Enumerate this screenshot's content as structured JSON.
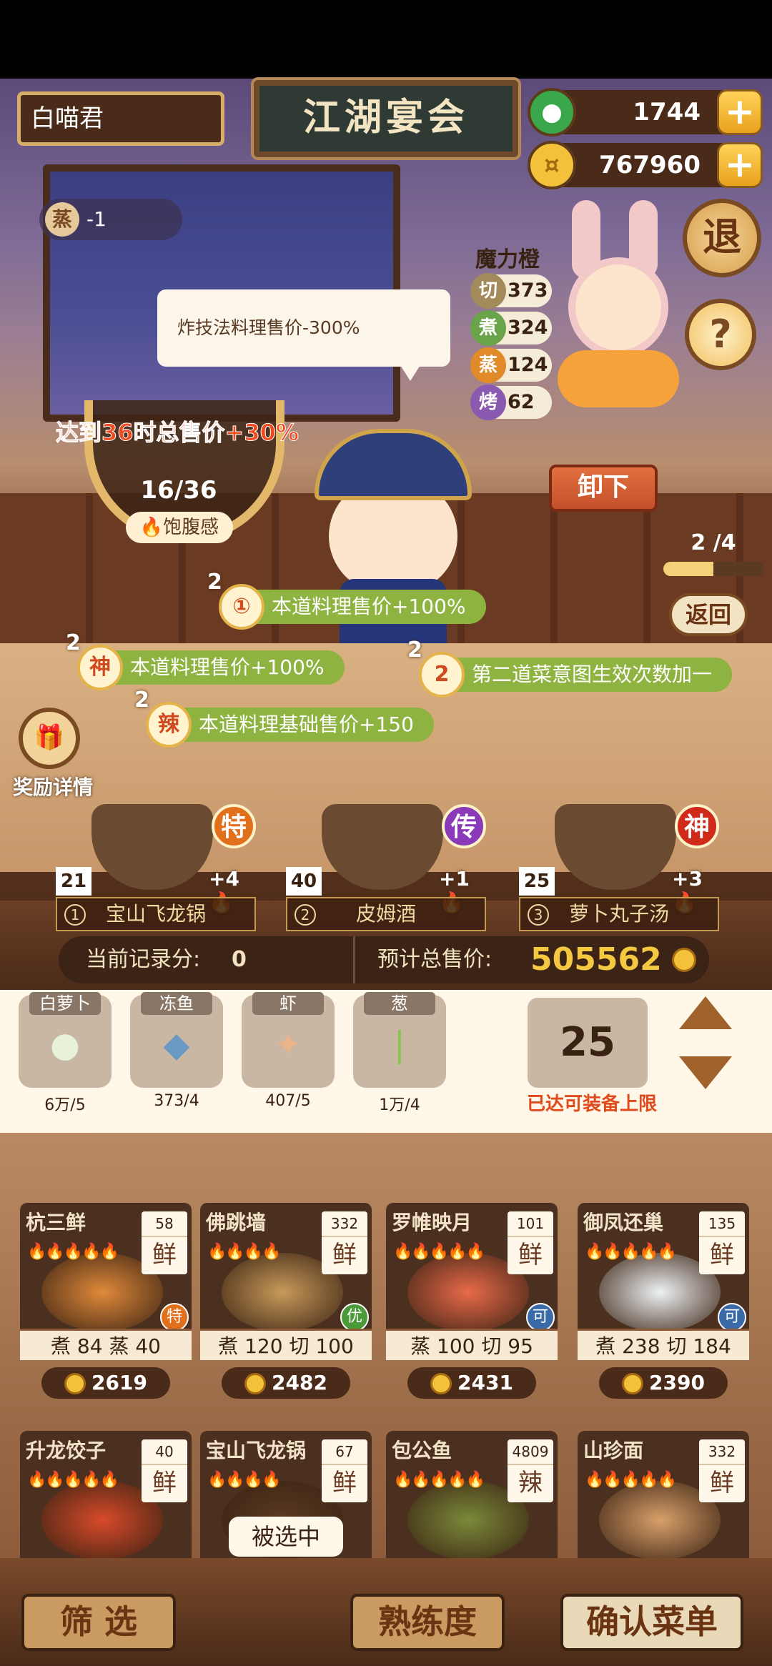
{
  "header": {
    "player_name": "白喵君",
    "title": "江湖宴会",
    "jade": "1744",
    "coins": "767960",
    "exit": "退",
    "help": "?"
  },
  "scene": {
    "steam_tag": {
      "char": "蒸",
      "value": "-1"
    },
    "tooltip": "炸技法料理售价-300%",
    "character": {
      "name": "魔力橙",
      "stats": [
        {
          "icon": "切",
          "value": "373",
          "color": "#a38a5a"
        },
        {
          "icon": "煮",
          "value": "324",
          "color": "#6aa44a"
        },
        {
          "icon": "蒸",
          "value": "124",
          "color": "#e08a2a"
        },
        {
          "icon": "烤",
          "value": "62",
          "color": "#8a5ab0"
        }
      ]
    },
    "unload": "卸下",
    "page": {
      "text": "2 /4",
      "fraction": 0.5
    },
    "back": "返回",
    "bowl": {
      "bonus": "达到36时总售价+30%",
      "value": "16/36",
      "label": "饱腹感"
    },
    "buffs": [
      {
        "level": "2",
        "icon": "①",
        "text": "本道料理售价+100%"
      },
      {
        "level": "2",
        "icon": "神",
        "text": "本道料理售价+100%"
      },
      {
        "level": "2",
        "icon": "2",
        "text": "第二道菜意图生效次数加一"
      },
      {
        "level": "2",
        "icon": "辣",
        "text": "本道料理基础售价+150"
      }
    ],
    "reward_label": "奖励详情",
    "slots": [
      {
        "num": "1",
        "name": "宝山飞龙锅",
        "qty": "21",
        "fire": "+4",
        "grade": "特",
        "grade_color": "#e0701c"
      },
      {
        "num": "2",
        "name": "皮姆酒",
        "qty": "40",
        "fire": "+1",
        "grade": "传",
        "grade_color": "#8a3ab8"
      },
      {
        "num": "3",
        "name": "萝卜丸子汤",
        "qty": "25",
        "fire": "+3",
        "grade": "神",
        "grade_color": "#d02a1a"
      }
    ],
    "score_label": "当前记录分:",
    "score_value": "0",
    "total_label": "预计总售价:",
    "total_value": "505562"
  },
  "ingredients": [
    {
      "name": "白萝卜",
      "count": "6万/5",
      "glyph": "●",
      "color": "#e8f2d8"
    },
    {
      "name": "冻鱼",
      "count": "373/4",
      "glyph": "◆",
      "color": "#6a9ac4"
    },
    {
      "name": "虾",
      "count": "407/5",
      "glyph": "✦",
      "color": "#e8b48a"
    },
    {
      "name": "葱",
      "count": "1万/4",
      "glyph": "❘",
      "color": "#8ac454"
    }
  ],
  "counter": {
    "value": "25",
    "limit": "已达可装备上限"
  },
  "dishes": [
    {
      "name": "杭三鲜",
      "num": "58",
      "tag": "鲜",
      "stars": "🔥🔥🔥🔥🔥",
      "skills": "煮 84  蒸 40",
      "price": "2619",
      "mark": "特",
      "mark_color": "#e0701c",
      "dish_color": "#e08a3a"
    },
    {
      "name": "佛跳墙",
      "num": "332",
      "tag": "鲜",
      "stars": "🔥🔥🔥🔥",
      "skills": "煮 120  切 100",
      "price": "2482",
      "mark": "优",
      "mark_color": "#4a9a3a",
      "dish_color": "#c89a5a"
    },
    {
      "name": "罗帷映月",
      "num": "101",
      "tag": "鲜",
      "stars": "🔥🔥🔥🔥🔥",
      "skills": "蒸 100  切 95",
      "price": "2431",
      "mark": "可",
      "mark_color": "#3a6aa8",
      "dish_color": "#e86a4a"
    },
    {
      "name": "御凤还巢",
      "num": "135",
      "tag": "鲜",
      "stars": "🔥🔥🔥🔥🔥",
      "skills": "煮 238  切 184",
      "price": "2390",
      "mark": "可",
      "mark_color": "#3a6aa8",
      "dish_color": "#eef2f4"
    },
    {
      "name": "升龙饺子",
      "num": "40",
      "tag": "鲜",
      "stars": "🔥🔥🔥🔥🔥",
      "skills": "",
      "price": "",
      "mark": "",
      "mark_color": "#3a6aa8",
      "dish_color": "#d84a2a"
    },
    {
      "name": "宝山飞龙锅",
      "num": "67",
      "tag": "鲜",
      "stars": "🔥🔥🔥🔥",
      "skills": "",
      "price": "",
      "mark": "",
      "mark_color": "#e0701c",
      "dish_color": "#5a3a22",
      "selected": "被选中"
    },
    {
      "name": "包公鱼",
      "num": "4809",
      "tag": "辣",
      "stars": "🔥🔥🔥🔥🔥",
      "skills": "",
      "price": "",
      "mark": "",
      "mark_color": "#3a6aa8",
      "dish_color": "#7a8a3a"
    },
    {
      "name": "山珍面",
      "num": "332",
      "tag": "鲜",
      "stars": "🔥🔥🔥🔥🔥",
      "skills": "",
      "price": "",
      "mark": "",
      "mark_color": "#3a6aa8",
      "dish_color": "#d8a06a"
    }
  ],
  "footer": {
    "filter": "筛 选",
    "mastery": "熟练度",
    "confirm": "确认菜单"
  }
}
